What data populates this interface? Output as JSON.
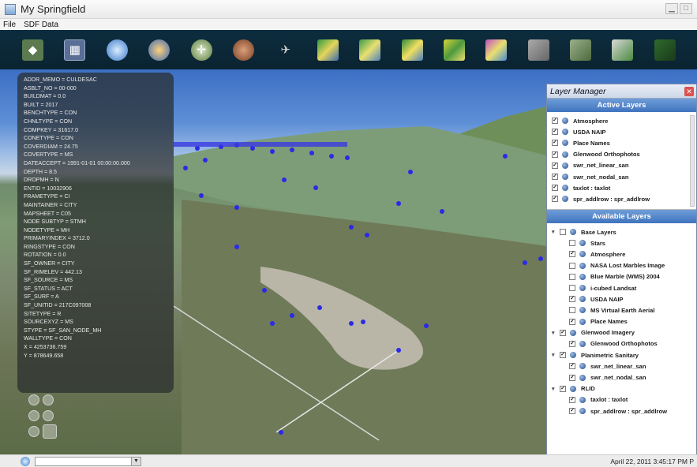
{
  "window": {
    "title": "My Springfield"
  },
  "menu": {
    "items": [
      "File",
      "SDF Data"
    ]
  },
  "toolbar": {
    "icons": [
      "layers-icon",
      "grid-icon",
      "globe-icon",
      "earth-satellite-icon",
      "compass-icon",
      "terrain-icon",
      "helicopter-icon",
      "map-thumbnail-icon",
      "map-thumbnail-icon",
      "map-thumbnail-icon",
      "map-thumbnail-icon",
      "map-thumbnail-icon",
      "map-thumbnail-icon",
      "map-thumbnail-icon",
      "map-thumbnail-icon",
      "map-thumbnail-icon"
    ]
  },
  "attributes": [
    "ADDR_MEMO = CULDESAC",
    "ASBLT_NO = 00-000",
    "BUILDMAT = 0.0",
    "BUILT = 2017",
    "BENCHTYPE = CON",
    "CHNLTYPE = CON",
    "COMPKEY = 31617.0",
    "CONETYPE = CON",
    "COVERDIAM = 24.75",
    "COVERTYPE = MS",
    "DATEACCEPT = 1991-01-01 00:00:00.000",
    "DEPTH = 8.5",
    "DROPMH = N",
    "ENTID = 10032906",
    "FRAMETYPE = CI",
    "MAINTAINER = CITY",
    "MAPSHEET = C05",
    "NODE SUBTYP = STMH",
    "NODETYPE = MH",
    "PRIMARYINDEX = 3712.0",
    "RINGSTYPE = CON",
    "ROTATION = 0.0",
    "SF_OWNER = CITY",
    "SF_RIMELEV = 442.13",
    "SF_SOURCE = MS",
    "SF_STATUS = ACT",
    "SF_SURF = A",
    "SF_UNITID = 217C097008",
    "SITETYPE = R",
    "SOURCEXYZ = MS",
    "STYPE = SF_SAN_NODE_MH",
    "WALLTYPE = CON",
    "X = 4253736.759",
    "Y = 878649.658"
  ],
  "layer_manager": {
    "title": "Layer Manager",
    "active_header": "Active Layers",
    "active_layers": [
      {
        "label": "Atmosphere",
        "checked": true
      },
      {
        "label": "USDA NAIP",
        "checked": true
      },
      {
        "label": "Place Names",
        "checked": true
      },
      {
        "label": "Glenwood Orthophotos",
        "checked": true
      },
      {
        "label": "swr_net_linear_san",
        "checked": true
      },
      {
        "label": "swr_net_nodal_san",
        "checked": true
      },
      {
        "label": "taxlot : taxlot",
        "checked": true
      },
      {
        "label": "spr_addlrow : spr_addlrow",
        "checked": true
      }
    ],
    "available_header": "Available Layers",
    "available_layers": [
      {
        "label": "Base Layers",
        "checked": false,
        "level": 0,
        "group": true
      },
      {
        "label": "Stars",
        "checked": false,
        "level": 1,
        "group": false
      },
      {
        "label": "Atmosphere",
        "checked": true,
        "level": 1,
        "group": false
      },
      {
        "label": "NASA Lost Marbles Image",
        "checked": false,
        "level": 1,
        "group": false
      },
      {
        "label": "Blue Marble (WMS) 2004",
        "checked": false,
        "level": 1,
        "group": false
      },
      {
        "label": "i-cubed Landsat",
        "checked": false,
        "level": 1,
        "group": false
      },
      {
        "label": "USDA NAIP",
        "checked": true,
        "level": 1,
        "group": false
      },
      {
        "label": "MS Virtual Earth Aerial",
        "checked": false,
        "level": 1,
        "group": false
      },
      {
        "label": "Place Names",
        "checked": true,
        "level": 1,
        "group": false
      },
      {
        "label": "Glenwood Imagery",
        "checked": true,
        "level": 0,
        "group": true
      },
      {
        "label": "Glenwood Orthophotos",
        "checked": true,
        "level": 1,
        "group": false
      },
      {
        "label": "Planimetric Sanitary",
        "checked": true,
        "level": 0,
        "group": true
      },
      {
        "label": "swr_net_linear_san",
        "checked": true,
        "level": 1,
        "group": false
      },
      {
        "label": "swr_net_nodal_san",
        "checked": true,
        "level": 1,
        "group": false
      },
      {
        "label": "RLID",
        "checked": true,
        "level": 0,
        "group": true
      },
      {
        "label": "taxlot : taxlot",
        "checked": true,
        "level": 1,
        "group": false
      },
      {
        "label": "spr_addlrow : spr_addlrow",
        "checked": true,
        "level": 1,
        "group": false
      }
    ]
  },
  "status": {
    "datetime": "April 22, 2011 3:45:17 PM P"
  }
}
